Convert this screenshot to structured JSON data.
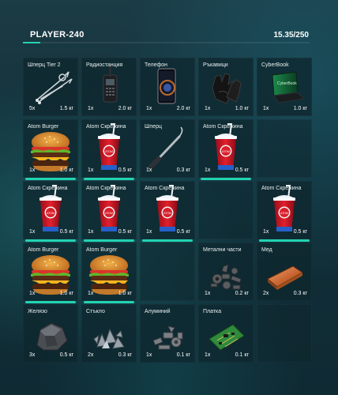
{
  "player": {
    "name": "PLAYER-240",
    "weight": "15.35/250",
    "load_fraction": 0.0614
  },
  "colors": {
    "accent": "#22d3b2"
  },
  "slots": [
    {
      "name": "Шперц Tier 2",
      "qty": "5x",
      "weight": "1.5 кг",
      "icon": "lockpick-tier2-icon",
      "highlight": false
    },
    {
      "name": "Радиостанция",
      "qty": "1x",
      "weight": "2.0 кг",
      "icon": "radio-icon",
      "highlight": false
    },
    {
      "name": "Телефон",
      "qty": "1x",
      "weight": "2.0 кг",
      "icon": "phone-icon",
      "highlight": false
    },
    {
      "name": "Ръкавици",
      "qty": "1x",
      "weight": "1.0 кг",
      "icon": "gloves-icon",
      "highlight": false
    },
    {
      "name": "CyberBook",
      "qty": "1x",
      "weight": "1.0 кг",
      "icon": "laptop-icon",
      "highlight": false
    },
    {
      "name": "Atom Burger",
      "qty": "1x",
      "weight": "1.0 кг",
      "icon": "burger-icon",
      "highlight": true
    },
    {
      "name": "Atom Скрежина",
      "qty": "1x",
      "weight": "0.5 кг",
      "icon": "slushie-icon",
      "highlight": true
    },
    {
      "name": "Шперц",
      "qty": "1x",
      "weight": "0.3 кг",
      "icon": "lockpick-icon",
      "highlight": false
    },
    {
      "name": "Atom Скрежина",
      "qty": "1x",
      "weight": "0.5 кг",
      "icon": "slushie-icon",
      "highlight": true
    },
    {
      "name": "",
      "qty": "",
      "weight": "",
      "icon": "",
      "highlight": false
    },
    {
      "name": "Atom Скрежина",
      "qty": "1x",
      "weight": "0.5 кг",
      "icon": "slushie-icon",
      "highlight": true
    },
    {
      "name": "Atom Скрежина",
      "qty": "1x",
      "weight": "0.5 кг",
      "icon": "slushie-icon",
      "highlight": true
    },
    {
      "name": "Atom Скрежина",
      "qty": "1x",
      "weight": "0.5 кг",
      "icon": "slushie-icon",
      "highlight": true
    },
    {
      "name": "",
      "qty": "",
      "weight": "",
      "icon": "",
      "highlight": false
    },
    {
      "name": "Atom Скрежина",
      "qty": "1x",
      "weight": "0.5 кг",
      "icon": "slushie-icon",
      "highlight": true
    },
    {
      "name": "Atom Burger",
      "qty": "1x",
      "weight": "1.0 кг",
      "icon": "burger-icon",
      "highlight": true
    },
    {
      "name": "Atom Burger",
      "qty": "1x",
      "weight": "1.0 кг",
      "icon": "burger-icon",
      "highlight": true
    },
    {
      "name": "",
      "qty": "",
      "weight": "",
      "icon": "",
      "highlight": false
    },
    {
      "name": "Метални части",
      "qty": "1x",
      "weight": "0.2 кг",
      "icon": "metal-parts-icon",
      "highlight": false
    },
    {
      "name": "Мед",
      "qty": "2x",
      "weight": "0.3 кг",
      "icon": "copper-ingot-icon",
      "highlight": false
    },
    {
      "name": "Желязо",
      "qty": "3x",
      "weight": "0.5 кг",
      "icon": "iron-ore-icon",
      "highlight": false
    },
    {
      "name": "Стъкло",
      "qty": "2x",
      "weight": "0.3 кг",
      "icon": "glass-shards-icon",
      "highlight": false
    },
    {
      "name": "Алуминий",
      "qty": "1x",
      "weight": "0.1 кг",
      "icon": "aluminium-scrap-icon",
      "highlight": false
    },
    {
      "name": "Платка",
      "qty": "1x",
      "weight": "0.1 кг",
      "icon": "circuit-board-icon",
      "highlight": false
    },
    {
      "name": "",
      "qty": "",
      "weight": "",
      "icon": "",
      "highlight": false
    }
  ]
}
